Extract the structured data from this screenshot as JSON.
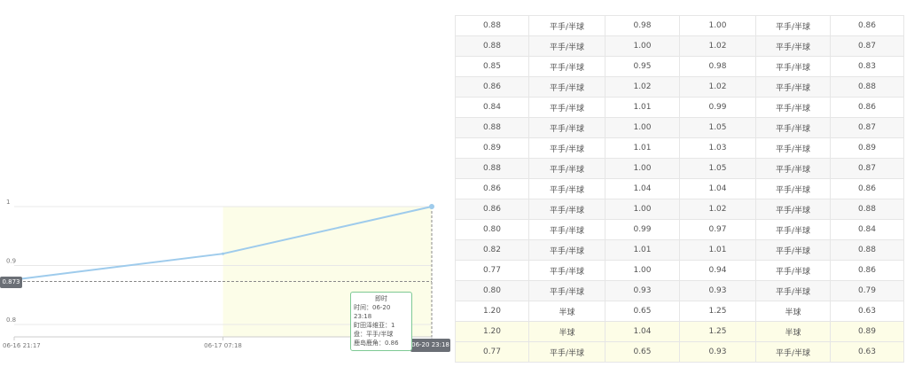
{
  "chart_data": {
    "type": "line",
    "x": [
      "06-16 21:17",
      "06-17 07:18",
      "06-20 23:18"
    ],
    "series": [
      {
        "values": [
          0.873,
          0.92,
          1.0
        ]
      }
    ],
    "y_ticks": [
      "1",
      "0.9",
      "0.8"
    ],
    "ylim": [
      0.8,
      1.0
    ],
    "grid": true,
    "highlight_from": "06-17 07:18",
    "crosshair": {
      "y_label": "0.873",
      "x_label": "06-20 23:18"
    },
    "colors": {
      "line": "#9ecbec",
      "highlight": "#fcfde8",
      "grid": "#e8e8e8",
      "tooltip_border": "#7ec994"
    },
    "tooltip": {
      "title": "即时",
      "lines": [
        "时间：06-20 23:18",
        "町田泽维亚：1",
        "盘：平手/半球",
        "鹿岛鹿角：0.86"
      ]
    }
  },
  "table": {
    "rows": [
      [
        "0.88",
        "平手/半球",
        "0.98",
        "1.00",
        "平手/半球",
        "0.86"
      ],
      [
        "0.88",
        "平手/半球",
        "1.00",
        "1.02",
        "平手/半球",
        "0.87"
      ],
      [
        "0.85",
        "平手/半球",
        "0.95",
        "0.98",
        "平手/半球",
        "0.83"
      ],
      [
        "0.86",
        "平手/半球",
        "1.02",
        "1.02",
        "平手/半球",
        "0.88"
      ],
      [
        "0.84",
        "平手/半球",
        "1.01",
        "0.99",
        "平手/半球",
        "0.86"
      ],
      [
        "0.88",
        "平手/半球",
        "1.00",
        "1.05",
        "平手/半球",
        "0.87"
      ],
      [
        "0.89",
        "平手/半球",
        "1.01",
        "1.03",
        "平手/半球",
        "0.89"
      ],
      [
        "0.88",
        "平手/半球",
        "1.00",
        "1.05",
        "平手/半球",
        "0.87"
      ],
      [
        "0.86",
        "平手/半球",
        "1.04",
        "1.04",
        "平手/半球",
        "0.86"
      ],
      [
        "0.86",
        "平手/半球",
        "1.00",
        "1.02",
        "平手/半球",
        "0.88"
      ],
      [
        "0.80",
        "平手/半球",
        "0.99",
        "0.97",
        "平手/半球",
        "0.84"
      ],
      [
        "0.82",
        "平手/半球",
        "1.01",
        "1.01",
        "平手/半球",
        "0.88"
      ],
      [
        "0.77",
        "平手/半球",
        "1.00",
        "0.94",
        "平手/半球",
        "0.86"
      ],
      [
        "0.80",
        "平手/半球",
        "0.93",
        "0.93",
        "平手/半球",
        "0.79"
      ],
      [
        "1.20",
        "半球",
        "0.65",
        "1.25",
        "半球",
        "0.63"
      ],
      [
        "1.20",
        "半球",
        "1.04",
        "1.25",
        "半球",
        "0.89"
      ],
      [
        "0.77",
        "平手/半球",
        "0.65",
        "0.93",
        "平手/半球",
        "0.63"
      ]
    ],
    "highlight_rows": [
      15,
      16
    ]
  }
}
